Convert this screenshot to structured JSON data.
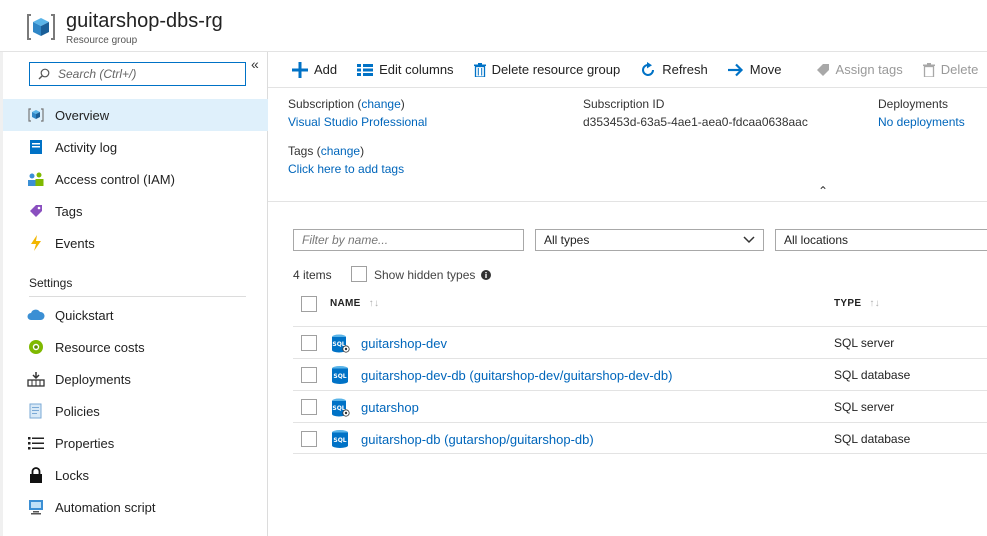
{
  "header": {
    "title": "guitarshop-dbs-rg",
    "subtitle": "Resource group"
  },
  "sidebar": {
    "search_placeholder": "Search (Ctrl+/)",
    "collapse_glyph": "«",
    "items": [
      {
        "label": "Overview",
        "icon": "resource-group-icon"
      },
      {
        "label": "Activity log",
        "icon": "activity-log-icon"
      },
      {
        "label": "Access control (IAM)",
        "icon": "people-icon"
      },
      {
        "label": "Tags",
        "icon": "tag-icon"
      },
      {
        "label": "Events",
        "icon": "lightning-icon"
      }
    ],
    "settings_label": "Settings",
    "settings_items": [
      {
        "label": "Quickstart",
        "icon": "cloud-icon"
      },
      {
        "label": "Resource costs",
        "icon": "cost-icon"
      },
      {
        "label": "Deployments",
        "icon": "deployments-icon"
      },
      {
        "label": "Policies",
        "icon": "policies-icon"
      },
      {
        "label": "Properties",
        "icon": "properties-icon"
      },
      {
        "label": "Locks",
        "icon": "lock-icon"
      },
      {
        "label": "Automation script",
        "icon": "automation-icon"
      }
    ]
  },
  "toolbar": {
    "add": "Add",
    "edit_columns": "Edit columns",
    "delete_rg": "Delete resource group",
    "refresh": "Refresh",
    "move": "Move",
    "assign_tags": "Assign tags",
    "delete": "Delete"
  },
  "essentials": {
    "subscription_label": "Subscription (",
    "change_link": "change",
    "close_paren": ")",
    "subscription_value": "Visual Studio Professional",
    "subscription_id_label": "Subscription ID",
    "subscription_id_value": "d353453d-63a5-4ae1-aea0-fdcaa0638aac",
    "deployments_label": "Deployments",
    "deployments_value": "No deployments",
    "tags_label": "Tags (",
    "tags_change": "change",
    "tags_value": "Click here to add tags",
    "collapse_glyph": "⌃"
  },
  "filters": {
    "name_placeholder": "Filter by name...",
    "types_selected": "All types",
    "locations_selected": "All locations"
  },
  "list": {
    "count": "4 items",
    "show_hidden": "Show hidden types",
    "col_name": "NAME",
    "col_type": "TYPE",
    "sort_glyph": "↑↓",
    "rows": [
      {
        "name": "guitarshop-dev",
        "type": "SQL server"
      },
      {
        "name": "guitarshop-dev-db (guitarshop-dev/guitarshop-dev-db)",
        "type": "SQL database"
      },
      {
        "name": "gutarshop",
        "type": "SQL server"
      },
      {
        "name": "guitarshop-db (gutarshop/guitarshop-db)",
        "type": "SQL database"
      }
    ]
  },
  "colors": {
    "accent": "#0072c6",
    "link": "#0066bb",
    "active_bg": "#dff0fb"
  }
}
